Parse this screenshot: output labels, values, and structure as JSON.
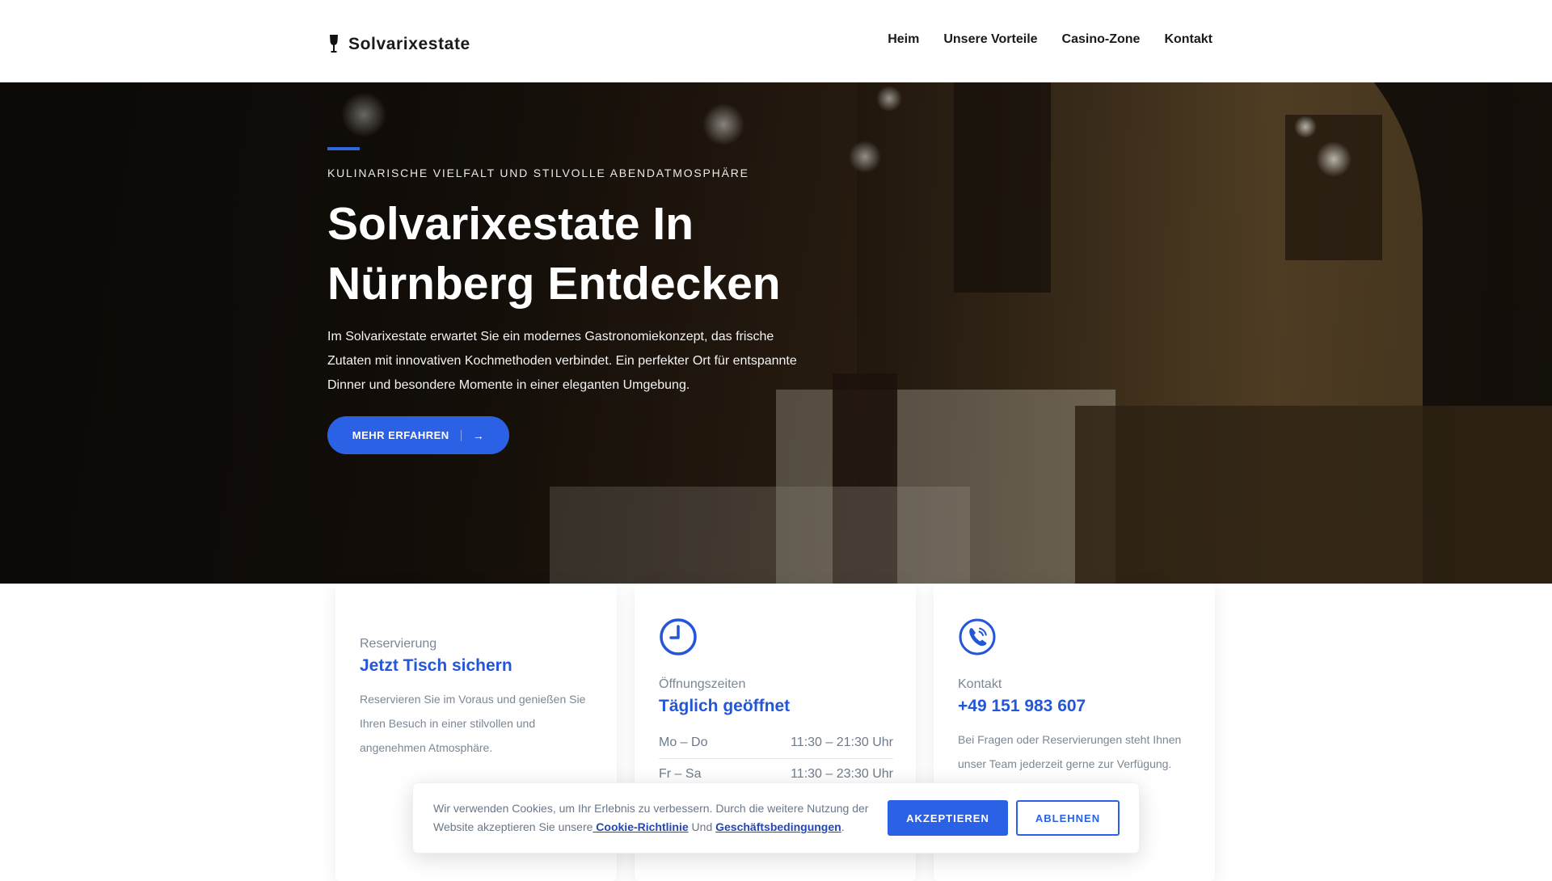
{
  "header": {
    "brand": "Solvarixestate",
    "nav": [
      {
        "label": "Heim"
      },
      {
        "label": "Unsere Vorteile"
      },
      {
        "label": "Casino-Zone"
      },
      {
        "label": "Kontakt"
      }
    ]
  },
  "hero": {
    "kicker": "KULINARISCHE VIELFALT UND STILVOLLE ABENDATMOSPHÄRE",
    "title": "Solvarixestate In Nürnberg Entdecken",
    "text": "Im Solvarixestate erwartet Sie ein modernes Gastronomiekonzept, das frische Zutaten mit innovativen Kochmethoden verbindet. Ein perfekter Ort für entspannte Dinner und besondere Momente in einer eleganten Umgebung.",
    "button_label": "MEHR ERFAHREN",
    "button_arrow": "→"
  },
  "cards": [
    {
      "label": "Reservierung",
      "heading": "Jetzt Tisch sichern",
      "text": "Reservieren Sie im Voraus und genießen Sie Ihren Besuch in einer stilvollen und angenehmen Atmosphäre."
    },
    {
      "icon": "clock-icon",
      "label": "Öffnungszeiten",
      "heading": "Täglich geöffnet",
      "hours": [
        {
          "days": "Mo – Do",
          "time": "11:30 – 21:30 Uhr"
        },
        {
          "days": "Fr – Sa",
          "time": "11:30 – 23:30 Uhr"
        }
      ]
    },
    {
      "icon": "phone-icon",
      "label": "Kontakt",
      "heading": "+49 151 983 607",
      "text": "Bei Fragen oder Reservierungen steht Ihnen unser Team jederzeit gerne zur Verfügung."
    }
  ],
  "cookie": {
    "text_before": "Wir verwenden Cookies, um Ihr Erlebnis zu verbessern. Durch die weitere Nutzung der Website akzeptieren Sie unsere",
    "policy_link": " Cookie-Richtlinie",
    "joiner": " Und ",
    "terms_link": "Geschäftsbedingungen",
    "text_after": ".",
    "accept_label": "AKZEPTIEREN",
    "decline_label": "ABLEHNEN"
  },
  "colors": {
    "accent": "#2b61e4",
    "heading_blue": "#2457d8",
    "muted_text": "#7a8796"
  }
}
